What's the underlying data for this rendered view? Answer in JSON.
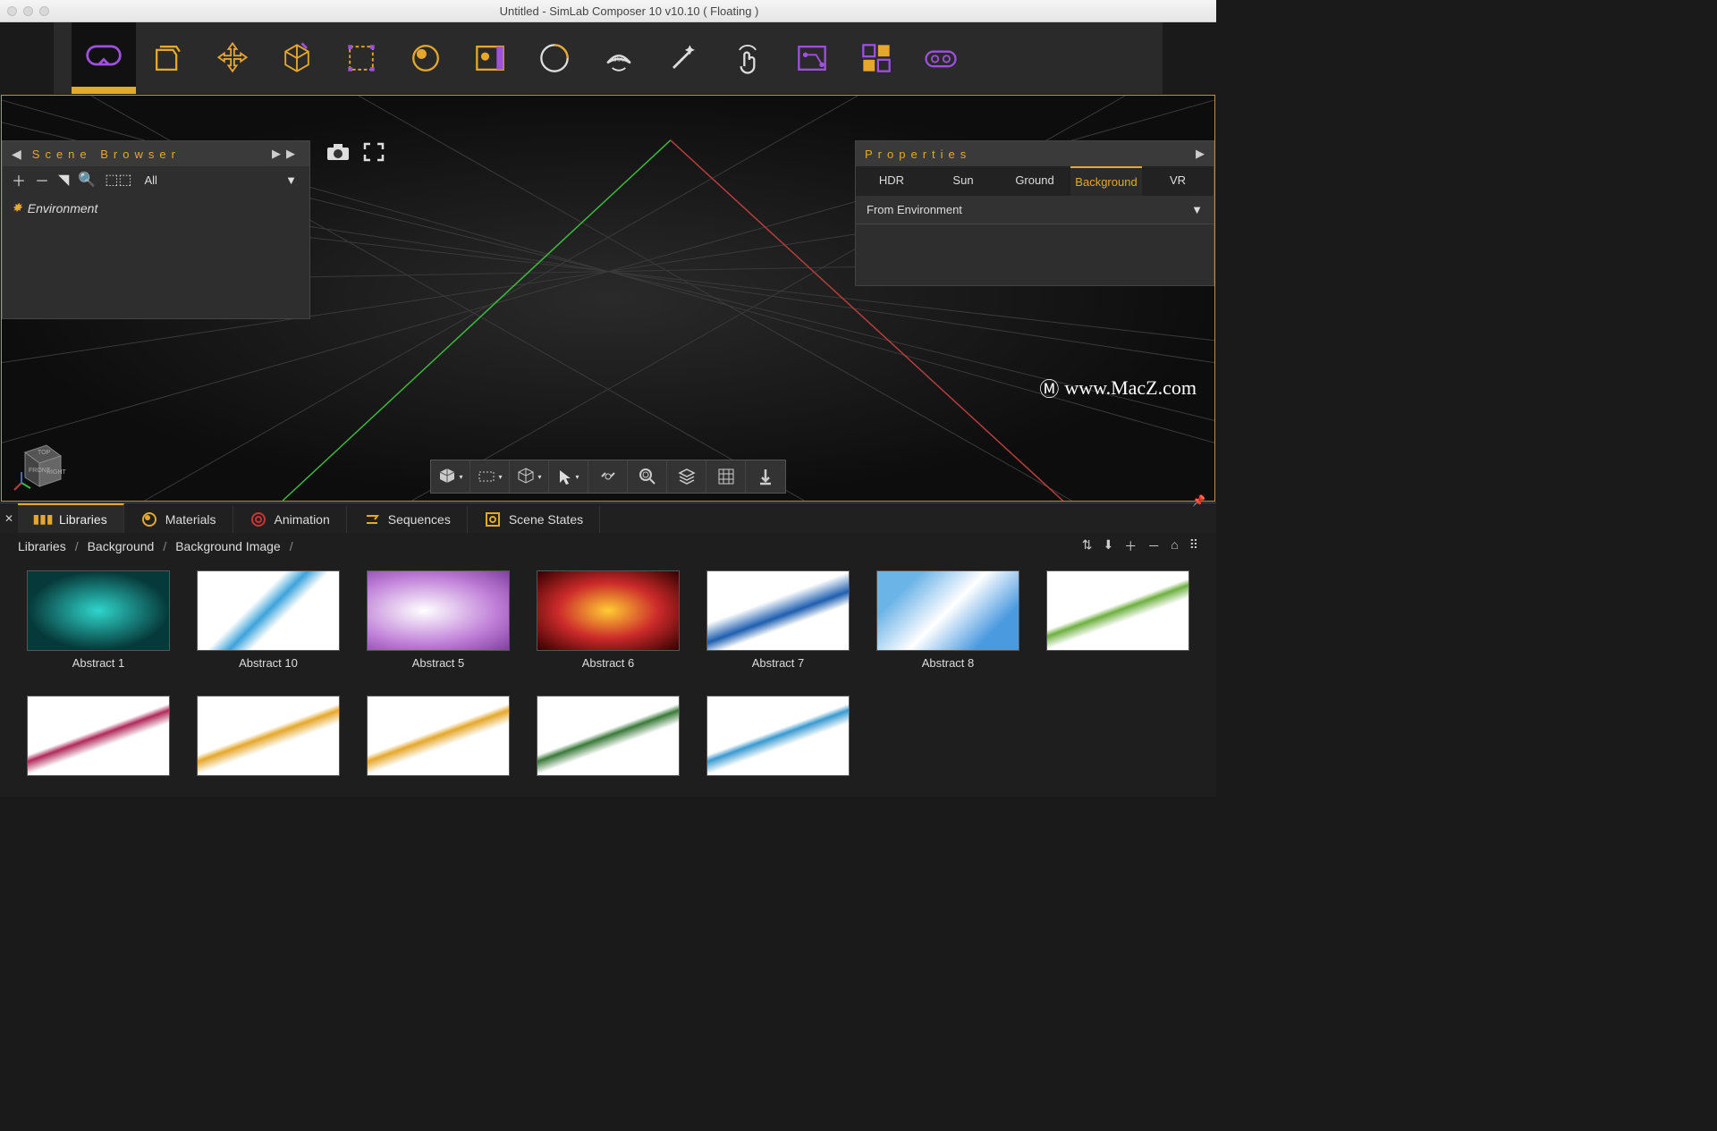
{
  "window": {
    "title": "Untitled - SimLab Composer 10 v10.10 ( Floating )"
  },
  "toolbar": {
    "items": [
      "vr-goggles-icon",
      "file-open-icon",
      "move-icon",
      "edit-cube-icon",
      "selection-rect-icon",
      "material-ball-icon",
      "preview-icon",
      "render-icon",
      "360-icon",
      "magic-wand-icon",
      "manipulate-icon",
      "flow-icon",
      "grid-settings-icon",
      "vr-preview-icon"
    ]
  },
  "sceneBrowser": {
    "title": "Scene Browser",
    "filter": "All",
    "root": "Environment"
  },
  "properties": {
    "title": "Properties",
    "tabs": [
      "HDR",
      "Sun",
      "Ground",
      "Background",
      "VR"
    ],
    "active": "Background",
    "bgSource": "From Environment"
  },
  "watermark": "www.MacZ.com",
  "bottomTabs": [
    {
      "label": "Libraries",
      "icon": "library-icon",
      "active": true,
      "color": "#e5a82c"
    },
    {
      "label": "Materials",
      "icon": "material-icon",
      "active": false,
      "color": "#e5a82c"
    },
    {
      "label": "Animation",
      "icon": "animation-icon",
      "active": false,
      "color": "#cc3333"
    },
    {
      "label": "Sequences",
      "icon": "sequences-icon",
      "active": false,
      "color": "#e5a82c"
    },
    {
      "label": "Scene States",
      "icon": "scene-states-icon",
      "active": false,
      "color": "#e5a82c"
    }
  ],
  "breadcrumb": [
    "Libraries",
    "Background",
    "Background Image"
  ],
  "library": [
    {
      "label": "Abstract 1"
    },
    {
      "label": "Abstract 10"
    },
    {
      "label": "Abstract 5"
    },
    {
      "label": "Abstract 6"
    },
    {
      "label": "Abstract 7"
    },
    {
      "label": "Abstract 8"
    },
    {
      "label": ""
    },
    {
      "label": ""
    },
    {
      "label": ""
    },
    {
      "label": ""
    },
    {
      "label": ""
    },
    {
      "label": ""
    }
  ]
}
